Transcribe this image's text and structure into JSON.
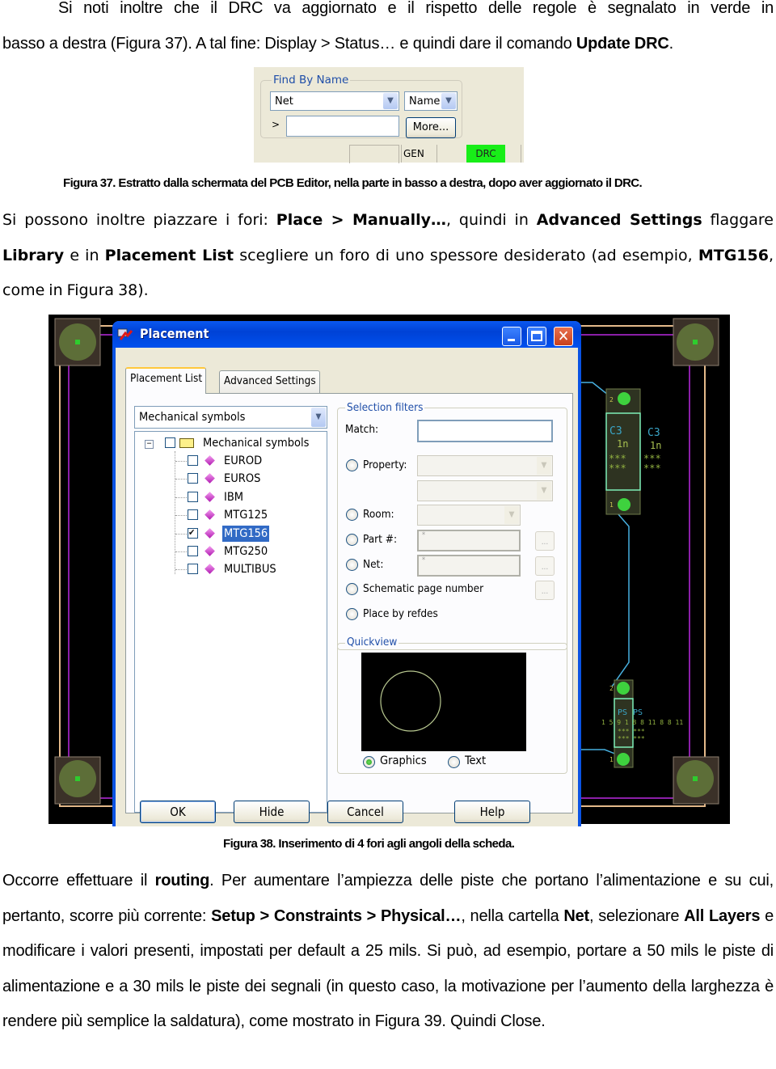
{
  "paragraphs": {
    "p1": {
      "line1": "Si noti inoltre che il DRC va aggiornato e il rispetto delle regole è segnalato in verde in",
      "line2_pre": "basso a destra (Figura 37). A tal fine: Display > Status… e quindi dare il comando ",
      "line2_bold": "Update DRC",
      "line2_post": "."
    },
    "p2": {
      "t1": "Si possono inoltre piazzare i fori: ",
      "b1": "Place > Manually…",
      "t2": ", quindi in ",
      "b2": "Advanced Settings",
      "t3": " flaggare ",
      "b3": "Library",
      "t4": " e in ",
      "b4": "Placement List",
      "t5": " scegliere un foro di uno spessore desiderato (ad esempio, ",
      "b5": "MTG156",
      "t6": ", come in Figura 38)."
    },
    "p3": {
      "t1": "Occorre effettuare il ",
      "b1": "routing",
      "t2": ". Per aumentare l’ampiezza delle piste che portano l’alimentazione e su cui, pertanto, scorre più corrente: ",
      "b2": "Setup > Constraints > Physical…",
      "t3": ", nella cartella ",
      "b3": "Net",
      "t4": ", selezionare ",
      "b4": "All Layers",
      "t5": " e modificare i valori presenti, impostati per default a 25 mils. Si può, ad esempio, portare a 50 mils le piste di alimentazione e a 30 mils le piste dei segnali (in questo caso, la motivazione per l’aumento della larghezza è rendere più semplice la saldatura), come mostrato in Figura 39. Quindi Close."
    }
  },
  "figure37": {
    "caption": "Figura 37. Estratto dalla schermata del PCB Editor, nella parte in basso a destra, dopo aver aggiornato il DRC.",
    "group_label": "Find By Name",
    "type_select": "Net",
    "mode_select": "Name",
    "prompt_symbol": ">",
    "name_input_value": "",
    "more_button": "More...",
    "status_gen": "GEN",
    "status_drc": "DRC",
    "drc_color": "#18ee18"
  },
  "figure38": {
    "caption": "Figura 38. Inserimento di 4 fori agli angoli della scheda.",
    "dialog": {
      "title": "Placement",
      "tabs": [
        {
          "label": "Placement List",
          "active": true
        },
        {
          "label": "Advanced Settings",
          "active": false
        }
      ],
      "category_select": "Mechanical symbols",
      "tree": {
        "root": "Mechanical symbols",
        "items": [
          {
            "name": "EUROD",
            "checked": false,
            "selected": false
          },
          {
            "name": "EUROS",
            "checked": false,
            "selected": false
          },
          {
            "name": "IBM",
            "checked": false,
            "selected": false
          },
          {
            "name": "MTG125",
            "checked": false,
            "selected": false
          },
          {
            "name": "MTG156",
            "checked": true,
            "selected": true
          },
          {
            "name": "MTG250",
            "checked": false,
            "selected": false
          },
          {
            "name": "MULTIBUS",
            "checked": false,
            "selected": false
          }
        ]
      },
      "selection_filters": {
        "legend": "Selection filters",
        "match_label": "Match:",
        "match_value": "",
        "property_label": "Property:",
        "room_label": "Room:",
        "part_label": "Part #:",
        "part_value": "*",
        "net_label": "Net:",
        "net_value": "*",
        "schematic_label": "Schematic page number",
        "refdes_label": "Place by refdes",
        "ellipsis": "..."
      },
      "quickview": {
        "legend": "Quickview",
        "graphics_label": "Graphics",
        "text_label": "Text",
        "selected_mode": "Graphics"
      },
      "buttons": {
        "ok": "OK",
        "hide": "Hide",
        "cancel": "Cancel",
        "help": "Help"
      }
    },
    "pcb": {
      "component_top": {
        "refdes": "C3",
        "value": "1n",
        "pin_top": "2",
        "pin_bottom": "1"
      },
      "component_bottom": {
        "refdes": "PS",
        "pin_top": "2",
        "pin_bottom": "1"
      }
    }
  }
}
